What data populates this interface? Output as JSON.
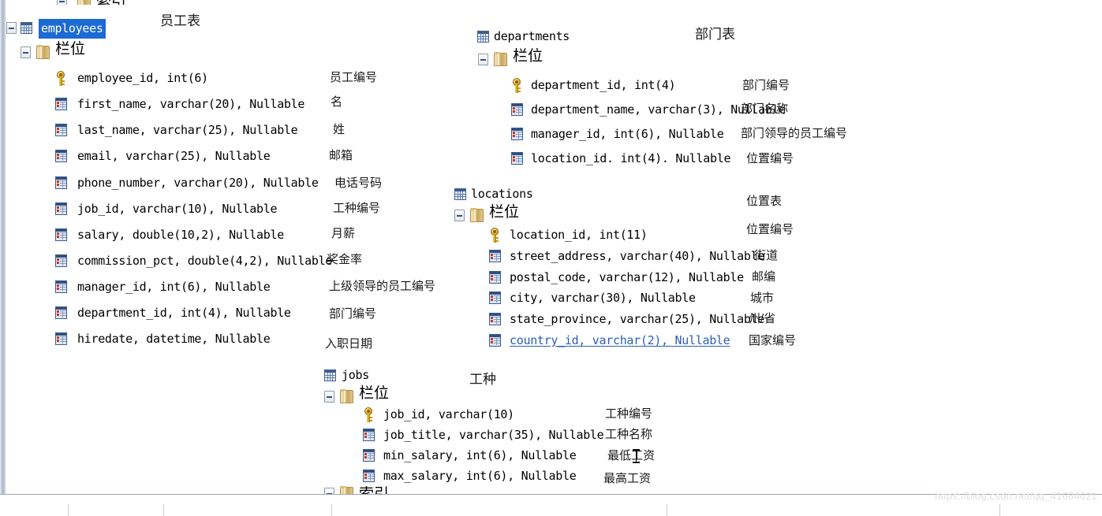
{
  "app": {
    "watermark": "https://blog.csdn.net/qq_41684621",
    "selection_color": "#1c6ad4",
    "link_color": "#2b5fb8",
    "folder_label": "栏位",
    "index_label": "索引"
  },
  "tables": [
    {
      "name": "employees",
      "comment": "员工表",
      "selected": true,
      "fields_folder": "栏位",
      "columns": [
        {
          "icon": "key-icon",
          "text": "employee_id,  int(6)",
          "comment": "员工编号"
        },
        {
          "icon": "column-icon",
          "text": "first_name,  varchar(20),  Nullable",
          "comment": "名"
        },
        {
          "icon": "column-icon",
          "text": "last_name,  varchar(25),  Nullable",
          "comment": "姓"
        },
        {
          "icon": "column-icon",
          "text": "email,  varchar(25),  Nullable",
          "comment": "邮箱"
        },
        {
          "icon": "column-icon",
          "text": "phone_number,  varchar(20),  Nullable",
          "comment": "电话号码"
        },
        {
          "icon": "column-icon",
          "text": "job_id,  varchar(10),  Nullable",
          "comment": "工种编号"
        },
        {
          "icon": "column-icon",
          "text": "salary,  double(10,2),  Nullable",
          "comment": "月薪"
        },
        {
          "icon": "column-icon",
          "text": "commission_pct,  double(4,2),  Nullable",
          "comment": "奖金率"
        },
        {
          "icon": "column-icon",
          "text": "manager_id,  int(6),  Nullable",
          "comment": "上级领导的员工编号"
        },
        {
          "icon": "column-icon",
          "text": "department_id,  int(4),  Nullable",
          "comment": "部门编号"
        },
        {
          "icon": "column-icon",
          "text": "hiredate,  datetime,  Nullable",
          "comment": "入职日期"
        }
      ]
    },
    {
      "name": "departments",
      "comment": "部门表",
      "fields_folder": "栏位",
      "columns": [
        {
          "icon": "key-icon",
          "text": "department_id,  int(4)",
          "comment": "部门编号"
        },
        {
          "icon": "column-icon",
          "text": "department_name,  varchar(3),  Nullable",
          "comment": "部门名称"
        },
        {
          "icon": "column-icon",
          "text": "manager_id,  int(6),  Nullable",
          "comment": "部门领导的员工编号"
        },
        {
          "icon": "column-icon",
          "text": "location_id.  int(4).  Nullable",
          "comment": "位置编号"
        }
      ]
    },
    {
      "name": "locations",
      "comment": "位置表",
      "fields_folder": "栏位",
      "columns": [
        {
          "icon": "key-icon",
          "text": "location_id,  int(11)",
          "comment": "位置编号"
        },
        {
          "icon": "column-icon",
          "text": "street_address,  varchar(40),  Nullable",
          "comment": "街道"
        },
        {
          "icon": "column-icon",
          "text": "postal_code,  varchar(12),  Nullable",
          "comment": "邮编"
        },
        {
          "icon": "column-icon",
          "text": "city,  varchar(30),  Nullable",
          "comment": "城市"
        },
        {
          "icon": "column-icon",
          "text": "state_province,  varchar(25),  Nullable",
          "comment": "州/省"
        },
        {
          "icon": "column-icon",
          "text": "country_id,  varchar(2),  Nullable",
          "comment": "国家编号",
          "link": true
        }
      ]
    },
    {
      "name": "jobs",
      "comment": "工种",
      "fields_folder": "栏位",
      "columns": [
        {
          "icon": "key-icon",
          "text": "job_id,  varchar(10)",
          "comment": "工种编号"
        },
        {
          "icon": "column-icon",
          "text": "job_title,  varchar(35),  Nullable",
          "comment": "工种名称"
        },
        {
          "icon": "column-icon",
          "text": "min_salary,  int(6),  Nullable",
          "comment": "最低工资"
        },
        {
          "icon": "column-icon",
          "text": "max_salary,  int(6),  Nullable",
          "comment": "最高工资"
        }
      ]
    }
  ]
}
